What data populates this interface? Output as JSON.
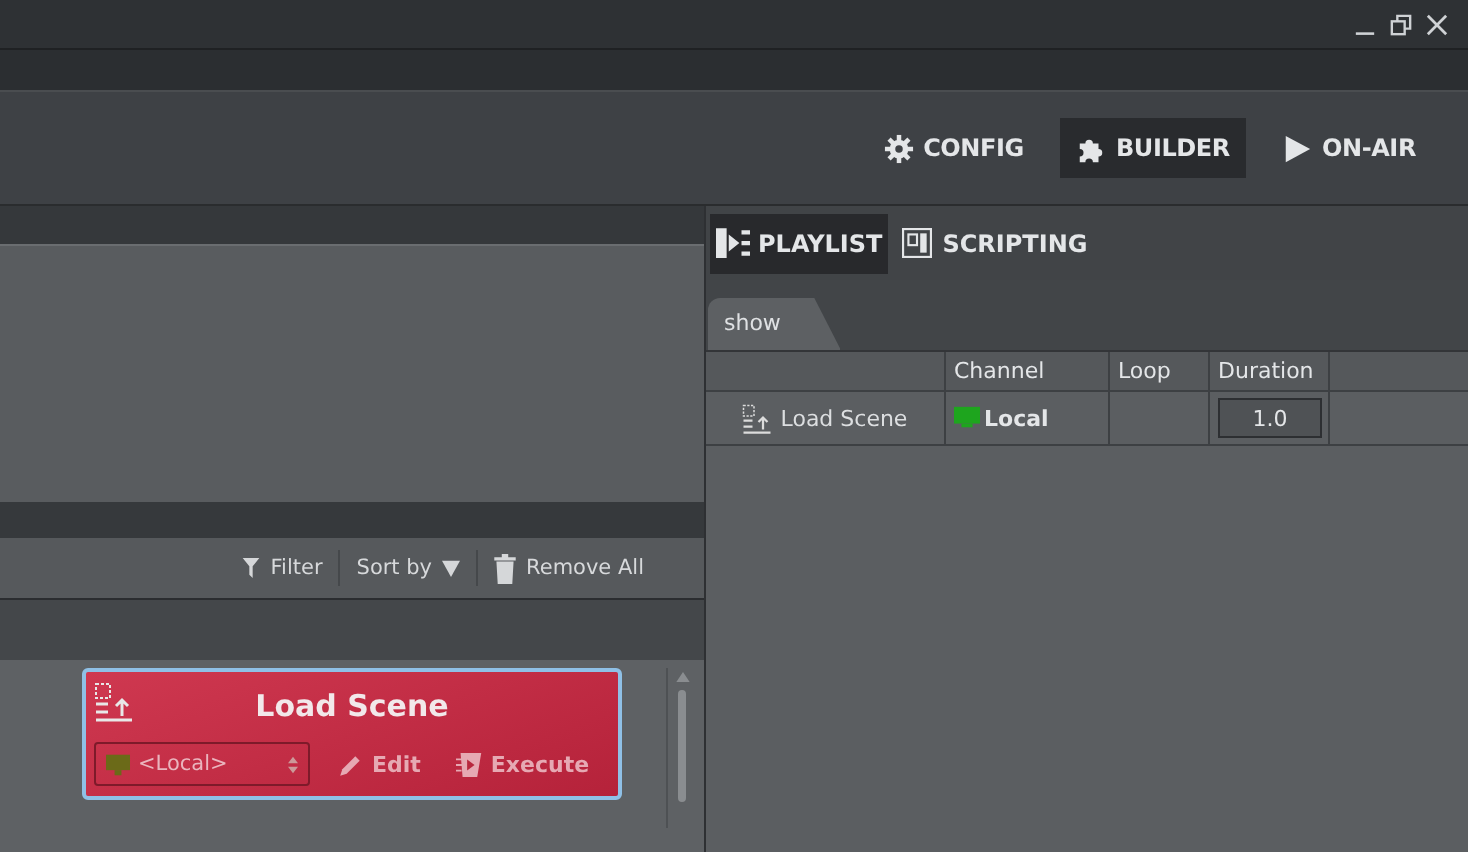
{
  "mode_tabs": [
    {
      "label": "CONFIG",
      "kind": "config",
      "selected": false
    },
    {
      "label": "BUILDER",
      "kind": "builder",
      "selected": true
    },
    {
      "label": "ON-AIR",
      "kind": "onair",
      "selected": false
    }
  ],
  "list_toolbar": {
    "filter": "Filter",
    "sort": "Sort by",
    "remove": "Remove All"
  },
  "card": {
    "title": "Load Scene",
    "channel": "<Local>",
    "edit": "Edit",
    "execute": "Execute"
  },
  "panel_tabs": [
    {
      "label": "PLAYLIST",
      "kind": "playlist",
      "selected": true
    },
    {
      "label": "SCRIPTING",
      "kind": "scripting",
      "selected": false
    }
  ],
  "playlist": {
    "tab": "show",
    "columns": [
      "Channel",
      "Loop",
      "Duration"
    ],
    "rows": [
      {
        "name": "Load Scene",
        "channel": "Local",
        "duration": "1.0"
      }
    ]
  }
}
